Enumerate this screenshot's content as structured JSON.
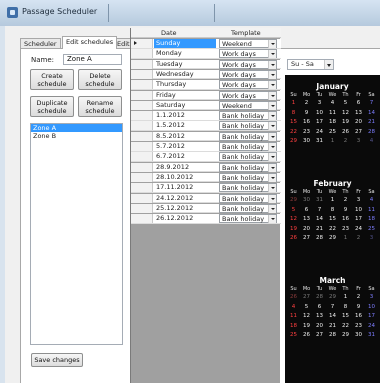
{
  "window": {
    "title": "Passage Scheduler"
  },
  "tabs": [
    {
      "label": "Scheduler"
    },
    {
      "label": "Edit schedules"
    },
    {
      "label": "Edit templates"
    }
  ],
  "schedule": {
    "name_label": "Name:",
    "name_value": "Zone A",
    "buttons": {
      "create": "Create\nschedule",
      "delete": "Delete\nschedule",
      "duplicate": "Duplicate\nschedule",
      "rename": "Rename\nschedule"
    },
    "zones": [
      {
        "label": "Zone A",
        "selected": true
      },
      {
        "label": "Zone B",
        "selected": false
      }
    ],
    "save_label": "Save changes"
  },
  "grid": {
    "headers": {
      "date": "Date",
      "template": "Template"
    },
    "rows": [
      {
        "date": "Sunday",
        "template": "Weekend"
      },
      {
        "date": "Monday",
        "template": "Work days"
      },
      {
        "date": "Tuesday",
        "template": "Work days"
      },
      {
        "date": "Wednesday",
        "template": "Work days"
      },
      {
        "date": "Thursday",
        "template": "Work days"
      },
      {
        "date": "Friday",
        "template": "Work days"
      },
      {
        "date": "Saturday",
        "template": "Weekend"
      },
      {
        "date": "1.1.2012",
        "template": "Bank holiday"
      },
      {
        "date": "1.5.2012",
        "template": "Bank holiday"
      },
      {
        "date": "8.5.2012",
        "template": "Bank holiday"
      },
      {
        "date": "5.7.2012",
        "template": "Bank holiday"
      },
      {
        "date": "6.7.2012",
        "template": "Bank holiday"
      },
      {
        "date": "28.9.2012",
        "template": "Bank holiday"
      },
      {
        "date": "28.10.2012",
        "template": "Bank holiday"
      },
      {
        "date": "17.11.2012",
        "template": "Bank holiday"
      },
      {
        "date": "24.12.2012",
        "template": "Bank holiday"
      },
      {
        "date": "25.12.2012",
        "template": "Bank holiday"
      },
      {
        "date": "26.12.2012",
        "template": "Bank holiday"
      }
    ]
  },
  "week_combo": {
    "value": "Su - Sa"
  },
  "calendar": {
    "dow": [
      "Su",
      "Mo",
      "Tu",
      "We",
      "Th",
      "Fr",
      "Sa"
    ],
    "months": [
      {
        "name": "January",
        "days": [
          "1",
          "2",
          "3",
          "4",
          "5",
          "6",
          "7",
          "8",
          "9",
          "10",
          "11",
          "12",
          "13",
          "14",
          "15",
          "16",
          "17",
          "18",
          "19",
          "20",
          "21",
          "22",
          "23",
          "24",
          "25",
          "26",
          "27",
          "28",
          "29",
          "30",
          "31",
          "1",
          "2",
          "3",
          "4"
        ],
        "dim_from": 31
      },
      {
        "name": "February",
        "days": [
          "29",
          "30",
          "31",
          "1",
          "2",
          "3",
          "4",
          "5",
          "6",
          "7",
          "8",
          "9",
          "10",
          "11",
          "12",
          "13",
          "14",
          "15",
          "16",
          "17",
          "18",
          "19",
          "20",
          "21",
          "22",
          "23",
          "24",
          "25",
          "26",
          "27",
          "28",
          "29",
          "1",
          "2",
          "3"
        ],
        "dim_until": 3,
        "dim_from": 32
      },
      {
        "name": "March",
        "days": [
          "26",
          "27",
          "28",
          "29",
          "1",
          "2",
          "3",
          "4",
          "5",
          "6",
          "7",
          "8",
          "9",
          "10",
          "11",
          "12",
          "13",
          "14",
          "15",
          "16",
          "17",
          "18",
          "19",
          "20",
          "21",
          "22",
          "23",
          "24",
          "25",
          "26",
          "27",
          "28",
          "29",
          "30",
          "31"
        ],
        "dim_until": 4
      }
    ]
  },
  "colors": {
    "selection": "#3399ff",
    "calendar_bg": "#0a0a0a",
    "sunday": "#ff4040",
    "saturday": "#7d7dff"
  },
  "icons": {
    "app": "calendar-app-icon",
    "row_indicator": "current-row-arrow-icon",
    "dropdown": "chevron-down-icon"
  }
}
